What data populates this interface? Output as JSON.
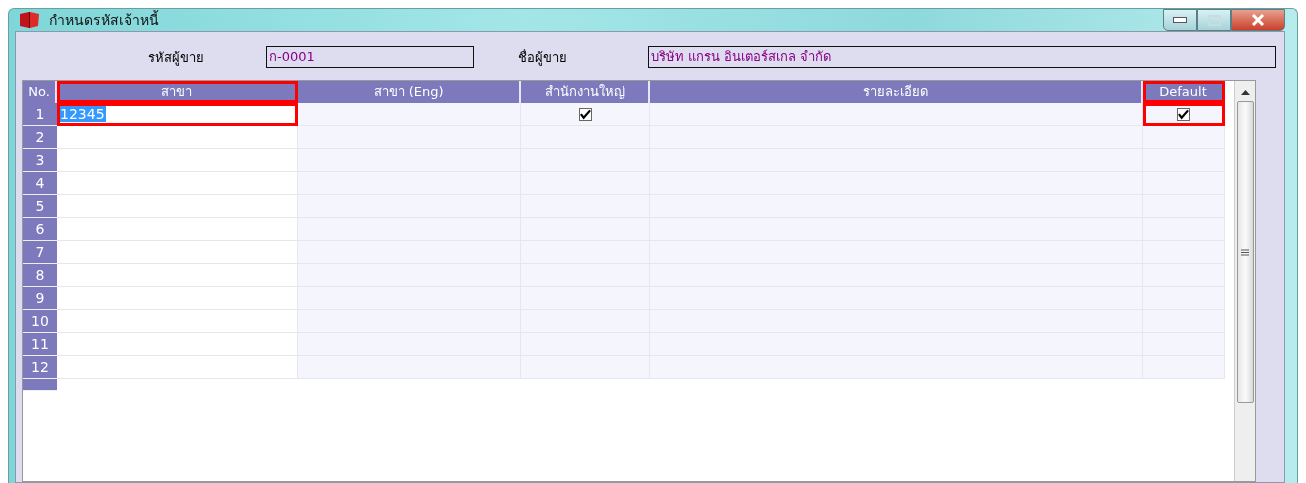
{
  "window": {
    "title": "กำหนดรหัสเจ้าหนี้"
  },
  "fields": [
    {
      "label": "รหัสผู้ขาย",
      "value": "ก-0001"
    },
    {
      "label": "ชื่อผู้ขาย",
      "value": "บริษัท แกรน อินเตอร์สเกล จำกัด"
    }
  ],
  "table": {
    "columns": [
      {
        "label": "No.",
        "highlighted": false
      },
      {
        "label": "สาขา",
        "highlighted": true
      },
      {
        "label": "สาขา (Eng)",
        "highlighted": false
      },
      {
        "label": "สำนักงานใหญ่",
        "highlighted": false
      },
      {
        "label": "รายละเอียด",
        "highlighted": false
      },
      {
        "label": "Default",
        "highlighted": true
      }
    ],
    "rows": [
      {
        "no": "1",
        "branch": "12345",
        "branch_selected": true,
        "head_office": true,
        "default": true
      },
      {
        "no": "2"
      },
      {
        "no": "3"
      },
      {
        "no": "4"
      },
      {
        "no": "5"
      },
      {
        "no": "6"
      },
      {
        "no": "7"
      },
      {
        "no": "8"
      },
      {
        "no": "9"
      },
      {
        "no": "10"
      },
      {
        "no": "11"
      },
      {
        "no": "12"
      }
    ]
  }
}
